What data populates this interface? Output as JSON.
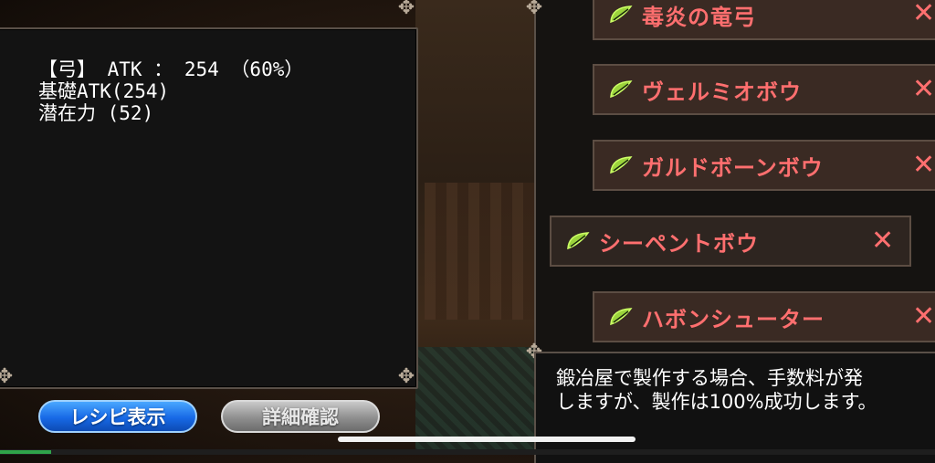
{
  "info_panel": {
    "line1": "【弓】 ATK ： 254 （60%）",
    "line2": "基礎ATK(254)",
    "line3": "潜在力 (52)"
  },
  "list": {
    "items": [
      {
        "label": "毒炎の竜弓",
        "icon": "bow-icon",
        "remove_icon": "close-icon"
      },
      {
        "label": "ヴェルミオボウ",
        "icon": "bow-icon",
        "remove_icon": "close-icon"
      },
      {
        "label": "ガルドボーンボウ",
        "icon": "bow-icon",
        "remove_icon": "close-icon"
      },
      {
        "label": "シーペントボウ",
        "icon": "bow-icon",
        "remove_icon": "close-icon"
      },
      {
        "label": "ハボンシューター",
        "icon": "bow-icon",
        "remove_icon": "close-icon"
      }
    ]
  },
  "description": {
    "line1": "鍛冶屋で製作する場合、手数料が発",
    "line2": "しますが、製作は100%成功します。"
  },
  "buttons": {
    "recipe_label": "レシピ表示",
    "detail_label": "詳細確認"
  },
  "progress": {
    "value": 0.055
  },
  "colors": {
    "accent_red": "#ff6f6f",
    "button_blue": "#1769e6",
    "button_gray": "#8f8f8f",
    "panel_bg": "#131313"
  }
}
